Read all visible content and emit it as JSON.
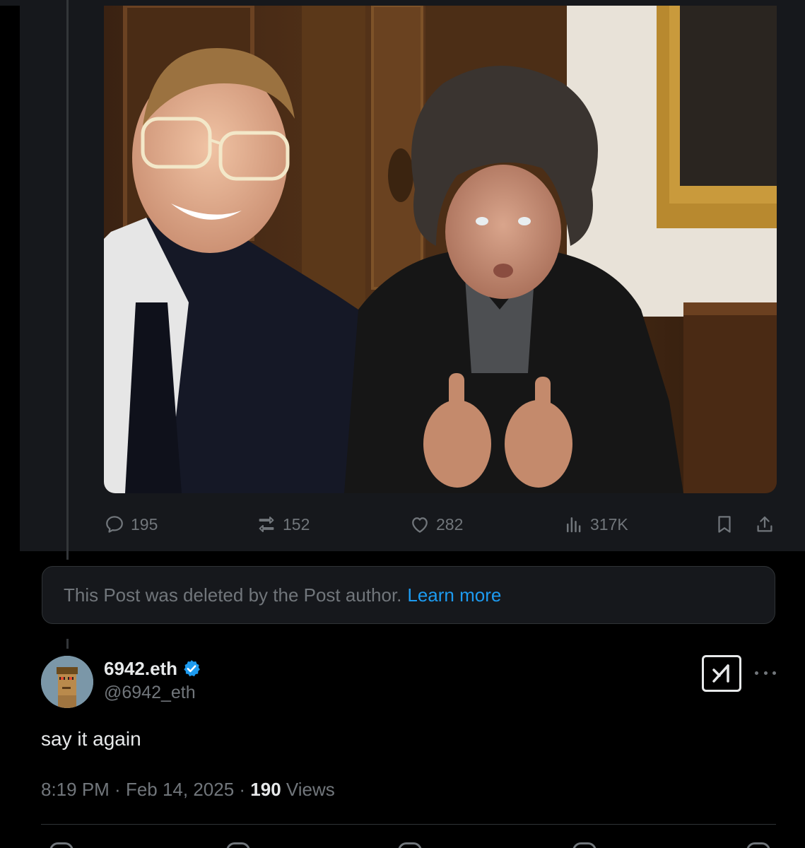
{
  "quoted_post": {
    "photo_alt": "",
    "stats": {
      "replies": "195",
      "reposts": "152",
      "likes": "282",
      "views": "317K"
    }
  },
  "deleted_notice": {
    "text": "This Post was deleted by the Post author.",
    "link_label": "Learn more"
  },
  "post": {
    "display_name": "6942.eth",
    "handle": "@6942_eth",
    "text": "say it again",
    "time": "8:19 PM",
    "separator": " · ",
    "date": "Feb 14, 2025",
    "views_count": "190",
    "views_label": "Views"
  },
  "icons": {
    "reply": "reply-icon",
    "repost": "repost-icon",
    "like": "heart-icon",
    "views": "views-icon",
    "bookmark": "bookmark-icon",
    "share": "share-icon",
    "verified": "verified-badge-icon",
    "grok": "grok-icon",
    "more": "more-icon"
  },
  "colors": {
    "background": "#000000",
    "card": "#16181c",
    "muted_text": "#71767b",
    "primary_text": "#e7e9ea",
    "link": "#1d9bf0",
    "verified": "#1d9bf0"
  }
}
